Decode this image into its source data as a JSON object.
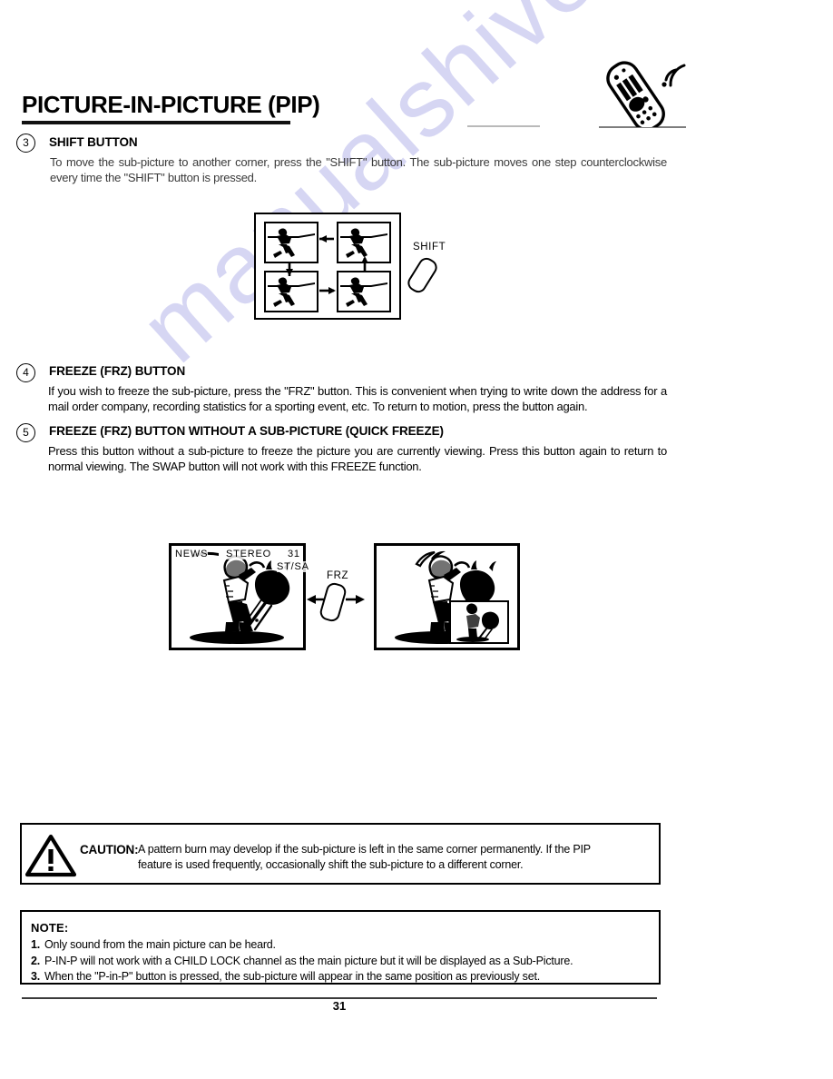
{
  "document": {
    "title": "PICTURE-IN-PICTURE (PIP)",
    "page_number": "31",
    "watermark": "manualshive.com"
  },
  "icons": {
    "remote": "remote-control-icon",
    "warning": "warning-triangle-icon"
  },
  "sections": [
    {
      "number": "3",
      "heading": "SHIFT BUTTON",
      "body": "To move the sub-picture to another corner, press the \"SHIFT\" button.  The sub-picture moves one step counterclockwise every time the \"SHIFT\" button is pressed."
    },
    {
      "number": "4",
      "heading": "FREEZE (FRZ) BUTTON",
      "body": "If you wish to freeze the sub-picture, press the \"FRZ\" button. This is convenient when trying to write down the address for a mail order company, recording statistics for a sporting event, etc.  To return to motion, press the button again."
    },
    {
      "number": "5",
      "heading": "FREEZE (FRZ) BUTTON WITHOUT A SUB-PICTURE (QUICK FREEZE)",
      "body": "Press this button without a sub-picture to freeze the picture you are currently viewing.  Press this button again to return to normal viewing.  The SWAP button will not work with this FREEZE function."
    }
  ],
  "shift_diagram": {
    "button_label": "SHIFT",
    "positions": [
      "top-left",
      "top-right",
      "bottom-left",
      "bottom-right"
    ],
    "rotation": "counterclockwise"
  },
  "frz_diagram": {
    "button_label": "FRZ",
    "osd": {
      "source": "NEWS",
      "audio": "STEREO",
      "channel": "31",
      "mode": "ST/SA"
    }
  },
  "caution": {
    "label": "CAUTION:",
    "line1": "A pattern burn may develop if the sub-picture is left in the same corner permanently.  If the PIP",
    "line2": "feature is used frequently, occasionally shift the sub-picture to a different corner."
  },
  "note": {
    "title": "NOTE:",
    "items": [
      {
        "n": "1.",
        "text": "Only sound from the main picture can be heard."
      },
      {
        "n": "2.",
        "text": "P-IN-P will not work with a CHILD LOCK channel as the main picture but it will be displayed as a Sub-Picture."
      },
      {
        "n": "3.",
        "text": "When the \"P-in-P\" button is pressed, the sub-picture will appear in the same position as previously set."
      }
    ]
  }
}
